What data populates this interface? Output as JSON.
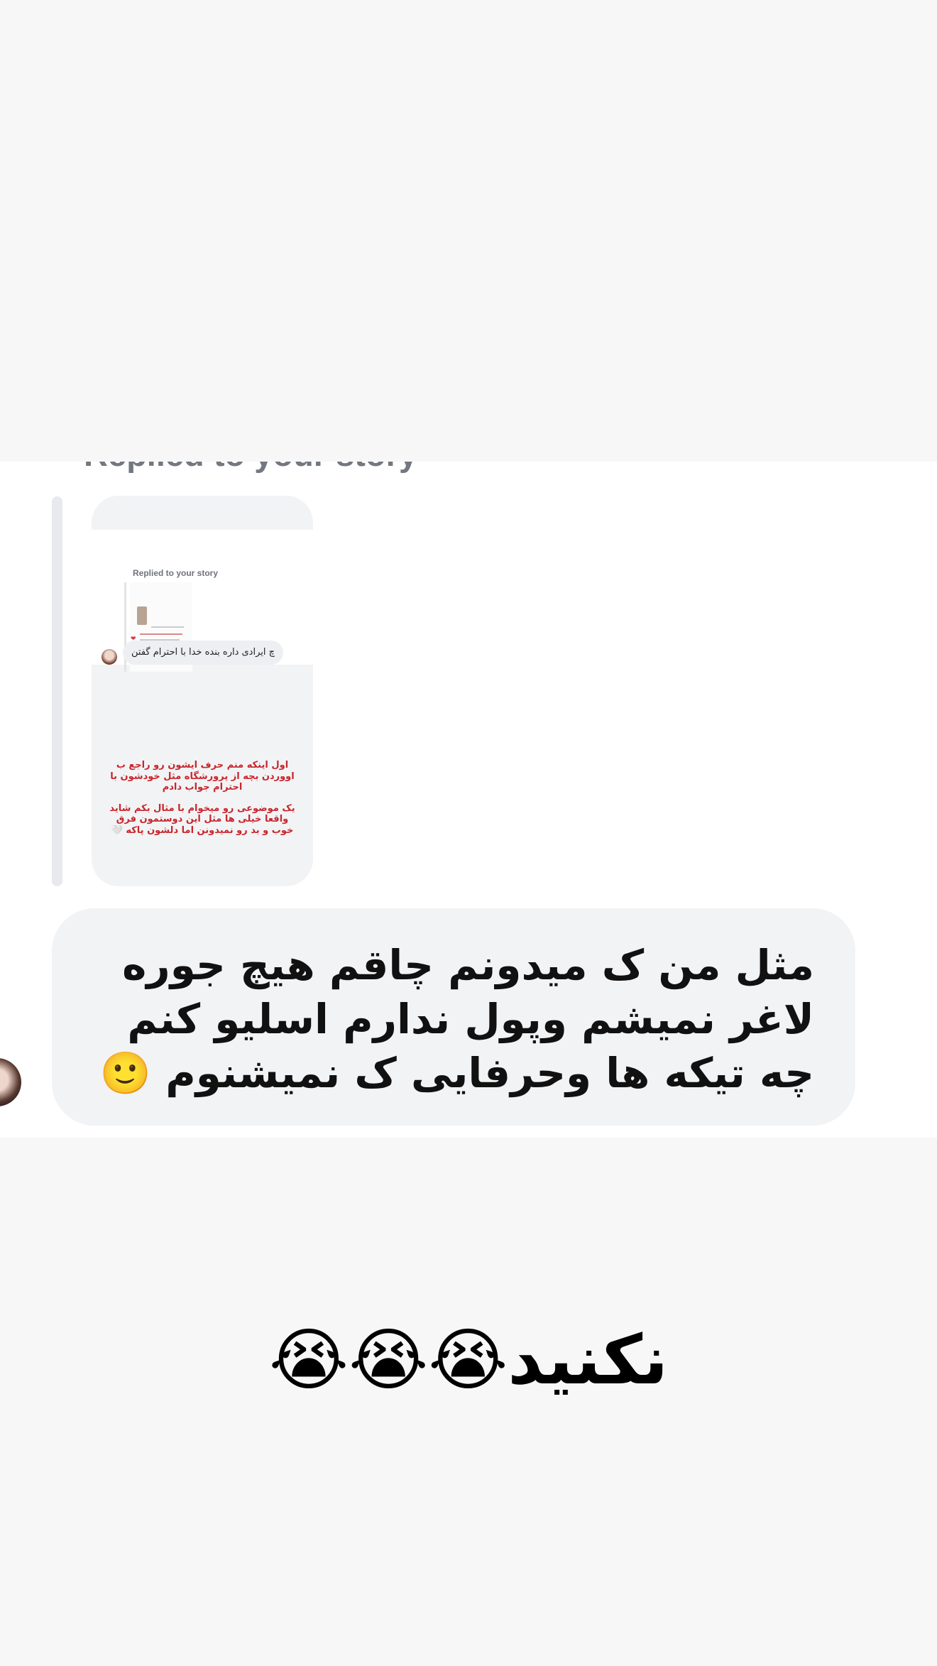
{
  "story_reply": {
    "header": "Replied to your story",
    "thumbnail": {
      "mini_header": "Replied to your story",
      "mini_reply": "چ ایرادی داره بنده خدا با احترام گفتن",
      "story_text_1": "اول اینکه منم حرف ایشون رو راجع ب اووردن بچه از پرورشگاه مثل خودشون با احترام جواب دادم",
      "story_text_2": "یک موضوعی رو میخوام با مثال بکم شاید واقعا خیلی ها مثل این دوستمون فرق خوب و بد رو نمیدونن اما دلشون پاکه 🤍"
    }
  },
  "message": {
    "text": "مثل من ک میدونم چاقم هیچ جوره لاغر نمیشم وپول ندارم اسلیو کنم چه تیکه ها وحرفایی ک نمیشنوم 🙂"
  },
  "caption": {
    "text": "نکنید😭😭😭"
  },
  "colors": {
    "page_bg": "#f7f7f8",
    "card_bg": "#ffffff",
    "bubble_bg": "#f2f3f5",
    "story_text": "#c8262c",
    "header_text": "#737880"
  },
  "icons": {
    "sender_avatar": "avatar",
    "mini_avatar": "avatar",
    "mini_heart": "heart-icon"
  }
}
